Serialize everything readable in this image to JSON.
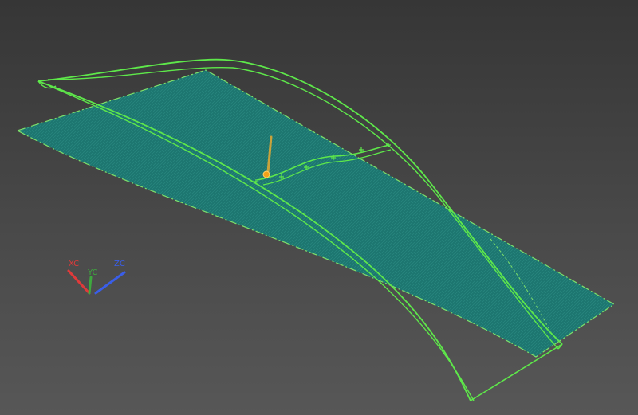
{
  "viewport": {
    "background_top": "#363636",
    "background_bottom": "#575757"
  },
  "colors": {
    "surface_fill": "#1d7670",
    "surface_edge": "#7ee06a",
    "curve": "#5ee84a",
    "vector": "#c8a23c",
    "point": "#f2a11a"
  },
  "triad": {
    "x_label": "XC",
    "y_label": "YC",
    "z_label": "ZC",
    "x_color": "#e03a3a",
    "y_color": "#3ea83e",
    "z_color": "#3a5ee8"
  }
}
